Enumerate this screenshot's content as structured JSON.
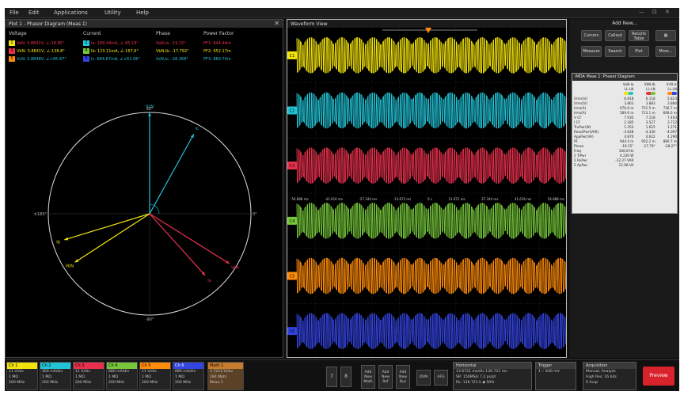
{
  "colors": {
    "ch1": "#f2e30c",
    "ch2": "#22c3d6",
    "ch3": "#e8304d",
    "ch4": "#76c73a",
    "ch5": "#ff8c0a",
    "ch6": "#3344e0",
    "math": "#c77b2e",
    "preview": "#d9232c"
  },
  "menubar": {
    "items": [
      "File",
      "Edit",
      "Applications",
      "Utility",
      "Help"
    ],
    "window_controls": "— ⊡ ✕"
  },
  "phasor": {
    "title": "Plot 1 - Phasor Diagram (Meas 1)",
    "close": "✕",
    "headers": [
      "Voltage",
      "Current",
      "Phase",
      "Power Factor"
    ],
    "rows": [
      {
        "vbadge": "1",
        "voltage": "VaN: 3.8841V, ∠-18.85°",
        "ibadge": "2",
        "current": "Ia: 189.44mA, ∠-95.19°",
        "phase": "VaN,Ia: -19.15°",
        "pf": "PF1: 944.44m"
      },
      {
        "vbadge": "3",
        "voltage": "VbN: 3.8841V, ∠-138.8°",
        "ibadge": "4",
        "current": "Ib: 123.11mA, ∠-167.6°",
        "phase": "VbN,Ib: -17.792°",
        "pf": "PF2: 952.17m"
      },
      {
        "vbadge": "5",
        "voltage": "VcN: 3.8848V, ∠+85.87°",
        "ibadge": "6",
        "current": "Ic: 684.67mA, ∠+61.66°",
        "phase": "VcN,Ic: -28.268°",
        "pf": "PF3: 880.74m"
      }
    ],
    "axis": {
      "top": "90°",
      "bottom": "-90°",
      "left": "±180°",
      "right": "0°"
    },
    "vectors": [
      {
        "name": "VcN",
        "angle": 90,
        "mag": 1.0,
        "color": "#22c3d6"
      },
      {
        "name": "Ic",
        "angle": 61,
        "mag": 0.9,
        "color": "#22c3d6"
      },
      {
        "name": "Ib",
        "angle": 197,
        "mag": 0.88,
        "color": "#f2e30c"
      },
      {
        "name": "VbN",
        "angle": 213,
        "mag": 0.88,
        "color": "#f2e30c"
      },
      {
        "name": "VaN",
        "angle": -32,
        "mag": 0.93,
        "color": "#e8304d"
      },
      {
        "name": "Ia",
        "angle": -48,
        "mag": 0.82,
        "color": "#e8304d"
      }
    ]
  },
  "waveform": {
    "title": "Waveform View",
    "channels": [
      {
        "label": "C1",
        "color": "#f2e30c"
      },
      {
        "label": "C2",
        "color": "#22c3d6"
      },
      {
        "label": "C3",
        "color": "#e8304d"
      },
      {
        "label": "C4",
        "color": "#76c73a"
      },
      {
        "label": "C5",
        "color": "#ff8c0a"
      },
      {
        "label": "C6",
        "color": "#3344e0"
      }
    ],
    "time_labels": [
      "-54.888 ms",
      "-41.616 ms",
      "-27.344 ms",
      "-13.672 ms",
      "0 s",
      "13.672 ms",
      "27.344 ms",
      "41.616 ms",
      "54.888 ms"
    ]
  },
  "rightpanel": {
    "title": "Add New...",
    "buttons": [
      "Cursors",
      "Callout",
      "Results Table",
      "Measure",
      "Search",
      "Plot",
      "More..."
    ],
    "meas_title": "IMDA Meas 1: Phasor Diagram",
    "col_headers": [
      "",
      "VaN-Ia\nLL-LN",
      "VbN-Ib\nLL-LN",
      "VcN-Ic\nLL-LN"
    ],
    "rows": [
      [
        "Vrms(V)",
        "6.818",
        "6.118",
        "5.823"
      ],
      [
        "Vrms(V)",
        "3.863",
        "3.883",
        "3.884"
      ],
      [
        "Irms(A)",
        "676.6 m",
        "751.5 m",
        "736.7 m"
      ],
      [
        "Irms(A)",
        "589.6 m",
        "723.1 m",
        "668.0 m"
      ],
      [
        "V CF",
        "7.935",
        "7.118",
        "7.403"
      ],
      [
        "I CF",
        "2.385",
        "3.527",
        "3.712"
      ],
      [
        "TruPwr(W)",
        "1.353",
        "1.615",
        "1.271"
      ],
      [
        "ReactPwr(VAR)",
        "-3.648",
        "-4.330",
        "-4.097"
      ],
      [
        "AppPwr(VA)",
        "4.870",
        "4.622",
        "4.290"
      ],
      [
        "PF",
        "944.4 m",
        "952.2 m",
        "880.7 m"
      ],
      [
        "Phase",
        "-19.15°",
        "-17.79°",
        "-28.27°"
      ],
      [
        "Freq",
        "166.8 Hz",
        "",
        ""
      ],
      [
        "Σ TrPwr",
        "4.239 W",
        "",
        ""
      ],
      [
        "Σ RxPwr",
        "-12.27 VAR",
        "",
        ""
      ],
      [
        "Σ ApPwr",
        "12.98 VA",
        "",
        ""
      ]
    ]
  },
  "bottombar": {
    "channels": [
      {
        "name": "Ch 1",
        "l1": "11 V/div",
        "l2": "1 MΩ",
        "l3": "200 MHz"
      },
      {
        "name": "Ch 2",
        "l1": "300 mA/div",
        "l2": "1 MΩ",
        "l3": "200 MHz"
      },
      {
        "name": "Ch 3",
        "l1": "11 V/div",
        "l2": "1 MΩ",
        "l3": "200 MHz"
      },
      {
        "name": "Ch 4",
        "l1": "680 mA/div",
        "l2": "1 MΩ",
        "l3": "200 MHz"
      },
      {
        "name": "Ch 5",
        "l1": "11 V/div",
        "l2": "1 MΩ",
        "l3": "200 MHz"
      },
      {
        "name": "Ch 6",
        "l1": "680 mA/div",
        "l2": "1 MΩ",
        "l3": "200 MHz"
      },
      {
        "name": "Math 1",
        "l1": "1.7213 V/div",
        "l2": "184 Mpts",
        "l3": "Mean 1"
      }
    ],
    "num_buttons": [
      "7",
      "8"
    ],
    "add_buttons": [
      "Add New Math",
      "Add New Ref",
      "Add New Bus"
    ],
    "small_buttons": [
      "DVM",
      "AFG"
    ],
    "horizontal": {
      "title": "Horizontal",
      "l1": "13.6721 ms/div   136.721 ms",
      "l2": "SR: 156MS/s     7.2 ps/pt",
      "l3": "RL: 136.721 k     ◆ 50%"
    },
    "trigger": {
      "title": "Trigger",
      "l1": "1  ⟋  440 mV",
      "l2": ""
    },
    "acquisition": {
      "title": "Acquisition",
      "l1": "Manual,   Analyze",
      "l2": "High Res: 16 bits",
      "l3": "0 Acqs"
    },
    "preview": "Preview"
  }
}
